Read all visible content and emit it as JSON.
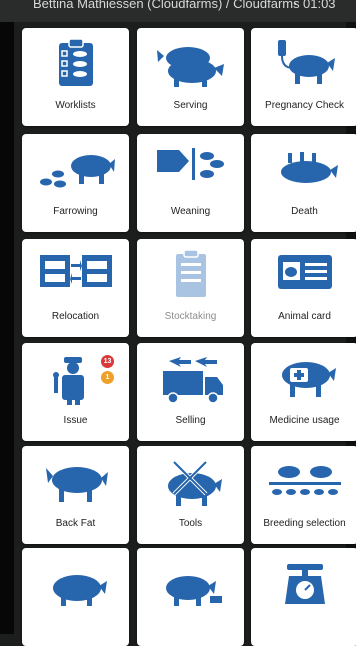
{
  "status_bar": {
    "title": "Bettina Mathiessen (Cloudfarms) / Cloudfarms",
    "time": "01:03"
  },
  "colors": {
    "icon_blue": "#2765ad",
    "icon_blue_disabled": "#a9c4e2",
    "badge_red": "#d83a3a",
    "badge_orange": "#eda12b"
  },
  "tiles": [
    {
      "label": "Worklists",
      "icon": "clipboard-checklist-pigs-icon"
    },
    {
      "label": "Serving",
      "icon": "pig-serving-icon"
    },
    {
      "label": "Pregnancy Check",
      "icon": "pig-scanner-icon"
    },
    {
      "label": "Farrowing",
      "icon": "sow-piglets-icon"
    },
    {
      "label": "Weaning",
      "icon": "weaning-icon"
    },
    {
      "label": "Death",
      "icon": "dead-pig-icon"
    },
    {
      "label": "Relocation",
      "icon": "pen-transfer-icon"
    },
    {
      "label": "Stocktaking",
      "icon": "stock-clipboard-icon",
      "disabled": true
    },
    {
      "label": "Animal card",
      "icon": "id-card-pig-icon"
    },
    {
      "label": "Issue",
      "icon": "worker-wrench-icon",
      "badges": [
        "13",
        "1"
      ]
    },
    {
      "label": "Selling",
      "icon": "truck-pigs-icon"
    },
    {
      "label": "Medicine usage",
      "icon": "medical-kit-pig-icon"
    },
    {
      "label": "Back Fat",
      "icon": "pig-backfat-icon"
    },
    {
      "label": "Tools",
      "icon": "pig-tools-icon"
    },
    {
      "label": "Breeding selection",
      "icon": "breeding-selection-icon"
    },
    {
      "label": "",
      "icon": "sow-feeding-icon"
    },
    {
      "label": "",
      "icon": "pig-feed-icon"
    },
    {
      "label": "",
      "icon": "weighing-scale-icon"
    }
  ]
}
